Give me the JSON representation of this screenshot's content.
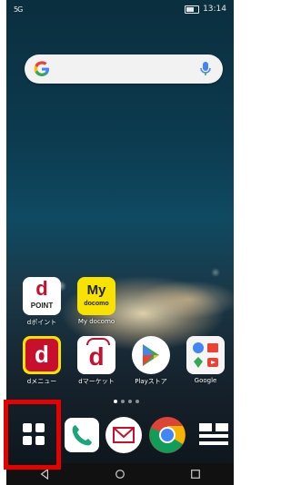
{
  "status_bar": {
    "left_indicator": "5G",
    "time": "13:14"
  },
  "search_bar": {
    "logo": "G"
  },
  "apps_row1": [
    {
      "name": "dpoint",
      "label": "dポイント",
      "line1": "d",
      "line2": "POINT"
    },
    {
      "name": "my-docomo",
      "label": "My docomo",
      "line1": "My",
      "line2": "docomo"
    }
  ],
  "apps_row2": [
    {
      "name": "dmenu",
      "label": "dメニュー",
      "glyph": "d"
    },
    {
      "name": "dmarket",
      "label": "dマーケット",
      "glyph": "d"
    },
    {
      "name": "play-store",
      "label": "Playストア"
    },
    {
      "name": "google",
      "label": "Google"
    }
  ],
  "dock": [
    "apps-drawer",
    "phone",
    "mail",
    "chrome",
    "menu"
  ],
  "page_indicator": {
    "pages": 4,
    "current": 1
  },
  "colors": {
    "highlight": "#e60000",
    "docomo_red": "#c8102e",
    "docomo_yellow": "#f7e200"
  }
}
